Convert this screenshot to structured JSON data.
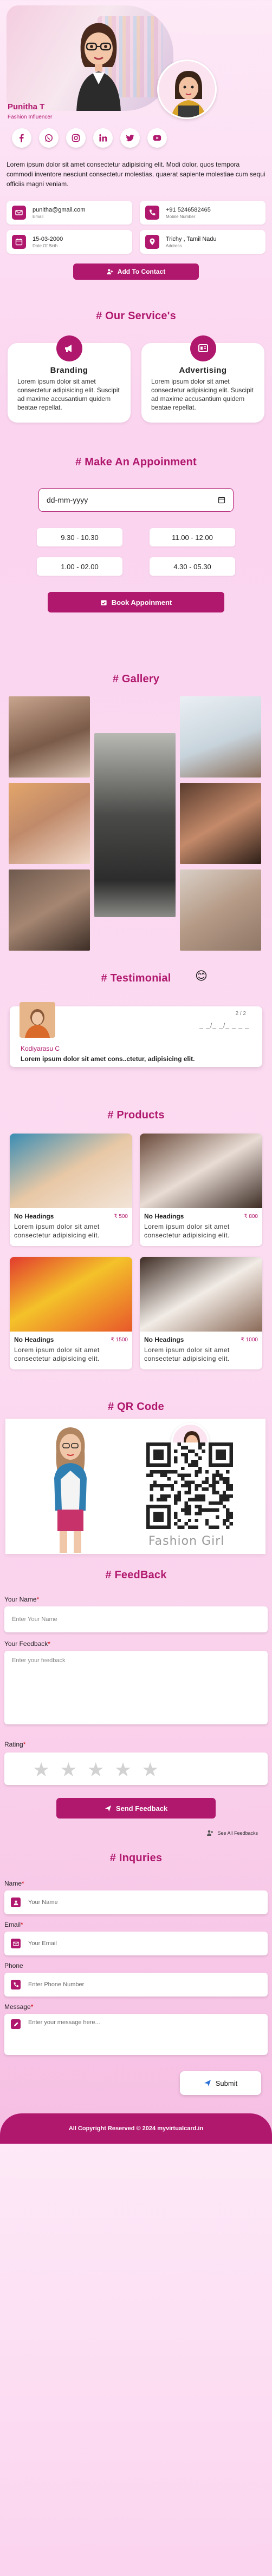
{
  "profile": {
    "name": "Punitha T",
    "role": "Fashion Influencer",
    "about": "Lorem ipsum dolor sit amet consectetur adipisicing elit. Modi dolor, quos tempora commodi inventore nesciunt consectetur molestias, quaerat sapiente molestiae cum sequi officiis magni veniam."
  },
  "socials": [
    "facebook-icon",
    "whatsapp-icon",
    "instagram-icon",
    "linkedin-icon",
    "twitter-icon",
    "youtube-icon"
  ],
  "contact": {
    "email": "punitha@gmail.com",
    "email_label": "Email",
    "mobile": "+91 5246582465",
    "mobile_label": "Mobile Number",
    "dob": "15-03-2000",
    "dob_label": "Date Of Birth",
    "address": "Trichy , Tamil Nadu",
    "address_label": "Address"
  },
  "add_contact_label": "Add To Contact",
  "services": {
    "title": "# Our Service's",
    "items": [
      {
        "name": "Branding",
        "desc": "Lorem ipsum dolor sit amet consectetur adipisicing elit. Suscipit ad maxime accusantium quidem beatae repellat."
      },
      {
        "name": "Advertising",
        "desc": "Lorem ipsum dolor sit amet consectetur adipisicing elit. Suscipit ad maxime accusantium quidem beatae repellat."
      }
    ]
  },
  "appointment": {
    "title": "# Make An Appoinment",
    "date_placeholder": "dd-mm-yyyy",
    "slots": [
      "9.30 - 10.30",
      "11.00 - 12.00",
      "1.00 - 02.00",
      "4.30 - 05.30"
    ],
    "book_label": "Book Appoinment"
  },
  "gallery": {
    "title": "# Gallery"
  },
  "testimonial": {
    "title": "# Testimonial",
    "name": "Kodiyarasu C",
    "quote": "Lorem ipsum dolor sit amet cons..ctetur, adipisicing elit.",
    "date": "_ _/_ _/_ _ _ _",
    "pager": "2 / 2"
  },
  "products": {
    "title": "# Products",
    "items": [
      {
        "name": "No Headings",
        "price": "₹ 500",
        "desc": "Lorem ipsum dolor sit amet consectetur adipisicing elit."
      },
      {
        "name": "No Headings",
        "price": "₹ 800",
        "desc": "Lorem ipsum dolor sit amet consectetur adipisicing elit."
      },
      {
        "name": "No Headings",
        "price": "₹ 1500",
        "desc": "Lorem ipsum dolor sit amet consectetur adipisicing elit."
      },
      {
        "name": "No Headings",
        "price": "₹ 1000",
        "desc": "Lorem ipsum dolor sit amet consectetur adipisicing elit."
      }
    ]
  },
  "qr": {
    "title": "# QR Code",
    "caption": "Fashion Girl"
  },
  "feedback": {
    "title": "# FeedBack",
    "name_label": "Your Name",
    "name_placeholder": "Enter Your Name",
    "fb_label": "Your Feedback",
    "fb_placeholder": "Enter your feedback",
    "rating_label": "Rating",
    "send_label": "Send Feedback",
    "see_all": "See All Feedbacks"
  },
  "inquiries": {
    "title": "# Inquries",
    "name_label": "Name",
    "name_placeholder": "Your Name",
    "email_label": "Email",
    "email_placeholder": "Your Email",
    "phone_label": "Phone",
    "phone_placeholder": "Enter Phone Number",
    "message_label": "Message",
    "message_placeholder": "Enter your message here...",
    "submit_label": "Submit"
  },
  "footer": "All Copyright Reserved © 2024 myvirtualcard.in",
  "colors": {
    "accent": "#b0186e",
    "background": "#fbd8f0"
  }
}
